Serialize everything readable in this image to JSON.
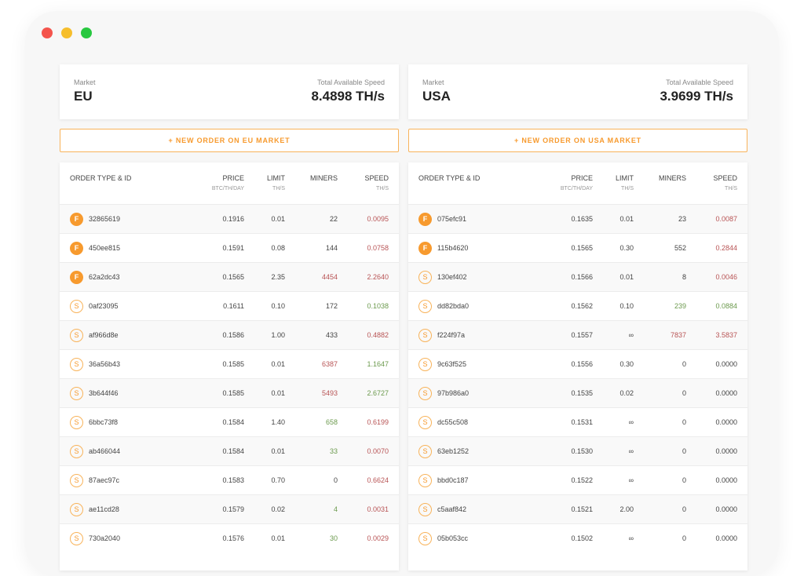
{
  "colors": {
    "accent": "#f79a2e",
    "red": "#b85455",
    "green": "#6c9a4e",
    "gray": "#444444"
  },
  "headers": {
    "type": "ORDER TYPE & ID",
    "price": "PRICE",
    "price_unit": "BTC/TH/DAY",
    "limit": "LIMIT",
    "limit_unit": "TH/S",
    "miners": "MINERS",
    "speed": "SPEED",
    "speed_unit": "TH/S"
  },
  "markets": [
    {
      "market_label": "Market",
      "name": "EU",
      "speed_label": "Total Available Speed",
      "speed_value": "8.4898 TH/s",
      "button_label": "+ NEW ORDER ON EU MARKET",
      "orders": [
        {
          "type": "F",
          "id": "32865619",
          "price": "0.1916",
          "limit": "0.01",
          "miners": "22",
          "miners_color": "gray",
          "speed": "0.0095",
          "speed_color": "red"
        },
        {
          "type": "F",
          "id": "450ee815",
          "price": "0.1591",
          "limit": "0.08",
          "miners": "144",
          "miners_color": "gray",
          "speed": "0.0758",
          "speed_color": "red"
        },
        {
          "type": "F",
          "id": "62a2dc43",
          "price": "0.1565",
          "limit": "2.35",
          "miners": "4454",
          "miners_color": "red",
          "speed": "2.2640",
          "speed_color": "red"
        },
        {
          "type": "S",
          "id": "0af23095",
          "price": "0.1611",
          "limit": "0.10",
          "miners": "172",
          "miners_color": "gray",
          "speed": "0.1038",
          "speed_color": "green"
        },
        {
          "type": "S",
          "id": "af966d8e",
          "price": "0.1586",
          "limit": "1.00",
          "miners": "433",
          "miners_color": "gray",
          "speed": "0.4882",
          "speed_color": "red"
        },
        {
          "type": "S",
          "id": "36a56b43",
          "price": "0.1585",
          "limit": "0.01",
          "miners": "6387",
          "miners_color": "red",
          "speed": "1.1647",
          "speed_color": "green"
        },
        {
          "type": "S",
          "id": "3b644f46",
          "price": "0.1585",
          "limit": "0.01",
          "miners": "5493",
          "miners_color": "red",
          "speed": "2.6727",
          "speed_color": "green"
        },
        {
          "type": "S",
          "id": "6bbc73f8",
          "price": "0.1584",
          "limit": "1.40",
          "miners": "658",
          "miners_color": "green",
          "speed": "0.6199",
          "speed_color": "red"
        },
        {
          "type": "S",
          "id": "ab466044",
          "price": "0.1584",
          "limit": "0.01",
          "miners": "33",
          "miners_color": "green",
          "speed": "0.0070",
          "speed_color": "red"
        },
        {
          "type": "S",
          "id": "87aec97c",
          "price": "0.1583",
          "limit": "0.70",
          "miners": "0",
          "miners_color": "gray",
          "speed": "0.6624",
          "speed_color": "red"
        },
        {
          "type": "S",
          "id": "ae11cd28",
          "price": "0.1579",
          "limit": "0.02",
          "miners": "4",
          "miners_color": "green",
          "speed": "0.0031",
          "speed_color": "red"
        },
        {
          "type": "S",
          "id": "730a2040",
          "price": "0.1576",
          "limit": "0.01",
          "miners": "30",
          "miners_color": "green",
          "speed": "0.0029",
          "speed_color": "red"
        }
      ]
    },
    {
      "market_label": "Market",
      "name": "USA",
      "speed_label": "Total Available Speed",
      "speed_value": "3.9699 TH/s",
      "button_label": "+ NEW ORDER ON USA MARKET",
      "orders": [
        {
          "type": "F",
          "id": "075efc91",
          "price": "0.1635",
          "limit": "0.01",
          "miners": "23",
          "miners_color": "gray",
          "speed": "0.0087",
          "speed_color": "red"
        },
        {
          "type": "F",
          "id": "115b4620",
          "price": "0.1565",
          "limit": "0.30",
          "miners": "552",
          "miners_color": "gray",
          "speed": "0.2844",
          "speed_color": "red"
        },
        {
          "type": "S",
          "id": "130ef402",
          "price": "0.1566",
          "limit": "0.01",
          "miners": "8",
          "miners_color": "gray",
          "speed": "0.0046",
          "speed_color": "red"
        },
        {
          "type": "S",
          "id": "dd82bda0",
          "price": "0.1562",
          "limit": "0.10",
          "miners": "239",
          "miners_color": "green",
          "speed": "0.0884",
          "speed_color": "green"
        },
        {
          "type": "S",
          "id": "f224f97a",
          "price": "0.1557",
          "limit": "∞",
          "miners": "7837",
          "miners_color": "red",
          "speed": "3.5837",
          "speed_color": "red"
        },
        {
          "type": "S",
          "id": "9c63f525",
          "price": "0.1556",
          "limit": "0.30",
          "miners": "0",
          "miners_color": "gray",
          "speed": "0.0000",
          "speed_color": "gray"
        },
        {
          "type": "S",
          "id": "97b986a0",
          "price": "0.1535",
          "limit": "0.02",
          "miners": "0",
          "miners_color": "gray",
          "speed": "0.0000",
          "speed_color": "gray"
        },
        {
          "type": "S",
          "id": "dc55c508",
          "price": "0.1531",
          "limit": "∞",
          "miners": "0",
          "miners_color": "gray",
          "speed": "0.0000",
          "speed_color": "gray"
        },
        {
          "type": "S",
          "id": "63eb1252",
          "price": "0.1530",
          "limit": "∞",
          "miners": "0",
          "miners_color": "gray",
          "speed": "0.0000",
          "speed_color": "gray"
        },
        {
          "type": "S",
          "id": "bbd0c187",
          "price": "0.1522",
          "limit": "∞",
          "miners": "0",
          "miners_color": "gray",
          "speed": "0.0000",
          "speed_color": "gray"
        },
        {
          "type": "S",
          "id": "c5aaf842",
          "price": "0.1521",
          "limit": "2.00",
          "miners": "0",
          "miners_color": "gray",
          "speed": "0.0000",
          "speed_color": "gray"
        },
        {
          "type": "S",
          "id": "05b053cc",
          "price": "0.1502",
          "limit": "∞",
          "miners": "0",
          "miners_color": "gray",
          "speed": "0.0000",
          "speed_color": "gray"
        }
      ]
    }
  ]
}
